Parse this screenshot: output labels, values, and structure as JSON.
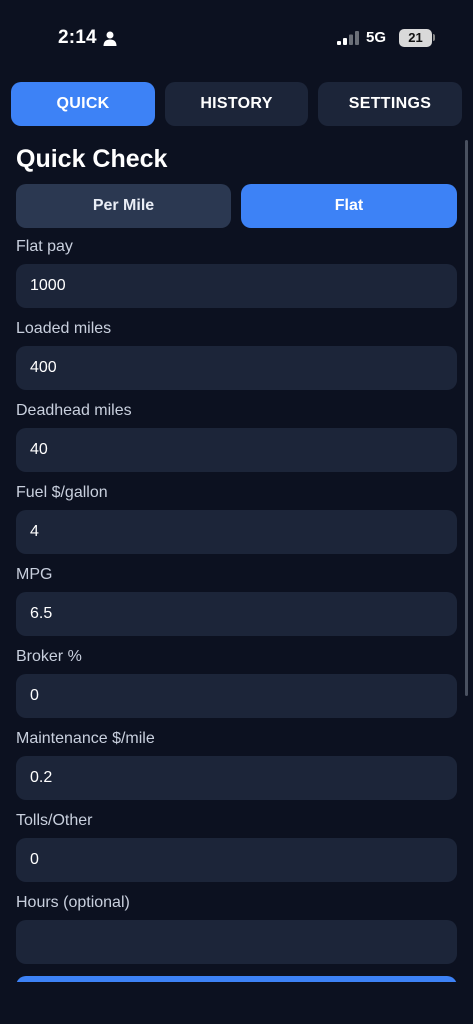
{
  "status_bar": {
    "time": "2:14",
    "network": "5G",
    "battery": "21"
  },
  "tabs": [
    {
      "label": "QUICK",
      "active": true
    },
    {
      "label": "HISTORY",
      "active": false
    },
    {
      "label": "SETTINGS",
      "active": false
    }
  ],
  "title": "Quick Check",
  "mode": {
    "per_mile": "Per Mile",
    "flat": "Flat",
    "selected": "Flat"
  },
  "fields": [
    {
      "label": "Flat pay",
      "value": "1000"
    },
    {
      "label": "Loaded miles",
      "value": "400"
    },
    {
      "label": "Deadhead miles",
      "value": "40"
    },
    {
      "label": "Fuel $/gallon",
      "value": "4"
    },
    {
      "label": "MPG",
      "value": "6.5"
    },
    {
      "label": "Broker %",
      "value": "0"
    },
    {
      "label": "Maintenance $/mile",
      "value": "0.2"
    },
    {
      "label": "Tolls/Other",
      "value": "0"
    },
    {
      "label": "Hours (optional)",
      "value": ""
    }
  ],
  "colors": {
    "accent": "#3d82f6",
    "background": "#0c1120",
    "surface": "#1c2539"
  }
}
